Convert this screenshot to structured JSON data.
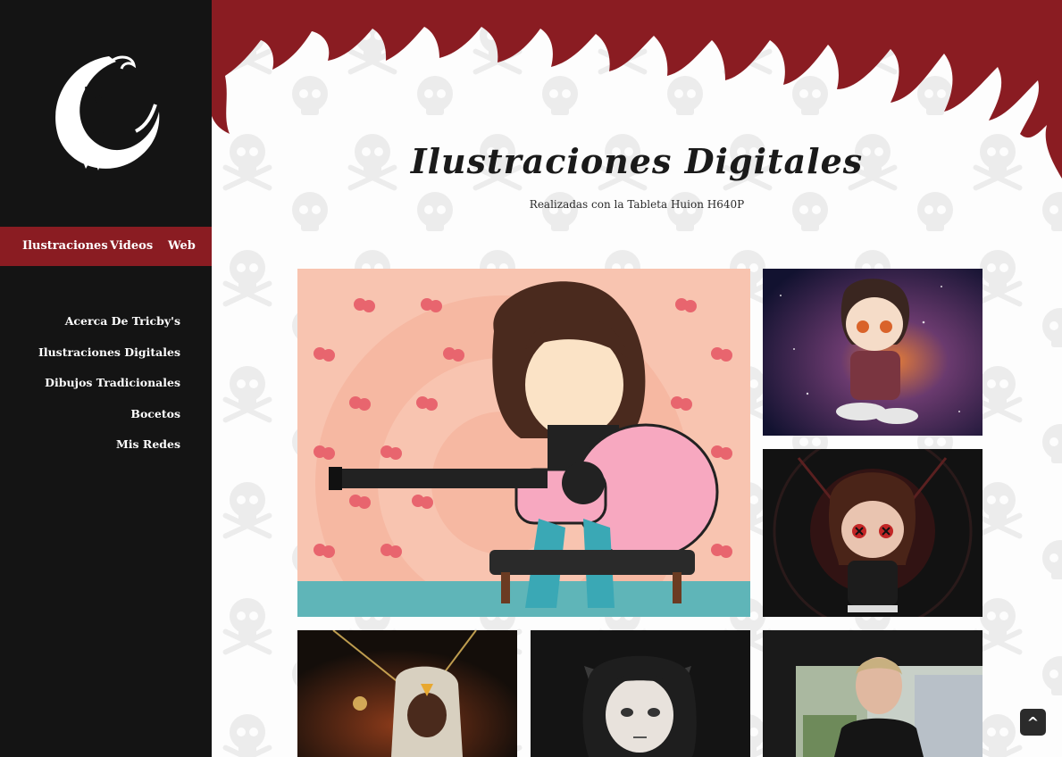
{
  "sidebar": {
    "logo_icon": "crescent-moon-face-logo",
    "tabs": [
      {
        "label": "Ilustraciones"
      },
      {
        "label": "Videos"
      },
      {
        "label": "Web"
      }
    ],
    "links": [
      {
        "label": "Acerca De Tricby's"
      },
      {
        "label": "Ilustraciones Digitales"
      },
      {
        "label": "Dibujos Tradicionales"
      },
      {
        "label": "Bocetos"
      },
      {
        "label": "Mis Redes"
      }
    ]
  },
  "header": {
    "title": "Ilustraciones Digitales",
    "subtitle": "Realizadas con la Tableta Huion H640P"
  },
  "gallery": {
    "items": [
      {
        "subject": "girl-with-pink-guitar-cherries"
      },
      {
        "subject": "chibi-boy-galaxy"
      },
      {
        "subject": "chibi-x-eyes-dark"
      },
      {
        "subject": "hooded-figure-light"
      },
      {
        "subject": "girl-cat-ears-dark"
      },
      {
        "subject": "bald-man-photo-street"
      }
    ]
  },
  "scroll_top": {
    "label": "^"
  },
  "colors": {
    "sidebar": "#141414",
    "accent": "#8a1c22",
    "flames": "#8a1c22"
  }
}
